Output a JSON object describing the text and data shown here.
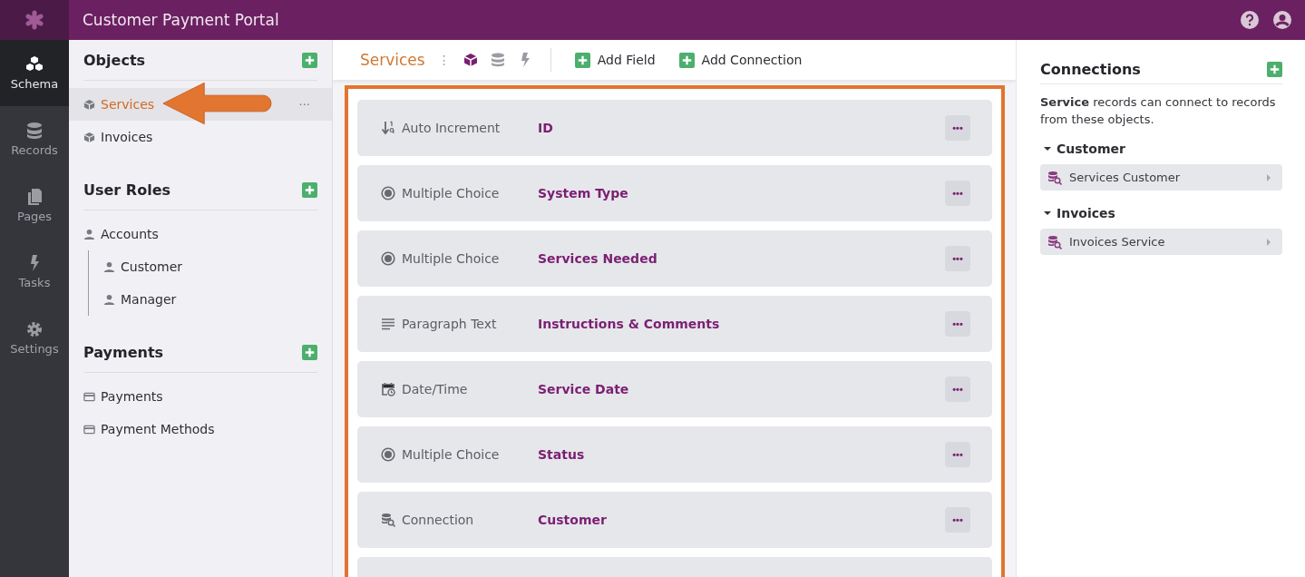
{
  "app": {
    "title": "Customer Payment Portal"
  },
  "nav": [
    {
      "label": "Schema",
      "kind": "schema",
      "selected": true
    },
    {
      "label": "Records",
      "kind": "records",
      "selected": false
    },
    {
      "label": "Pages",
      "kind": "pages",
      "selected": false
    },
    {
      "label": "Tasks",
      "kind": "tasks",
      "selected": false
    },
    {
      "label": "Settings",
      "kind": "settings",
      "selected": false
    }
  ],
  "sidebar": {
    "sections": [
      {
        "title": "Objects",
        "kind": "object",
        "items": [
          {
            "label": "Services",
            "selected": true,
            "menu": "···"
          },
          {
            "label": "Invoices",
            "selected": false
          }
        ]
      },
      {
        "title": "User Roles",
        "kind": "role",
        "items": [
          {
            "label": "Accounts",
            "selected": false,
            "children": [
              {
                "label": "Customer",
                "selected": false
              },
              {
                "label": "Manager",
                "selected": false
              }
            ]
          }
        ]
      },
      {
        "title": "Payments",
        "kind": "payment",
        "items": [
          {
            "label": "Payments",
            "selected": false
          },
          {
            "label": "Payment Methods",
            "selected": false
          }
        ]
      }
    ]
  },
  "toolbar": {
    "title": "Services",
    "menu": "⋮",
    "views": [
      {
        "kind": "object",
        "selected": true
      },
      {
        "kind": "records",
        "selected": false
      },
      {
        "kind": "tasks",
        "selected": false
      }
    ],
    "buttons": [
      "Add Field",
      "Add Connection"
    ]
  },
  "fields": [
    {
      "kind": "autoincrement",
      "type": "Auto Increment",
      "name": "ID",
      "menu": "•••"
    },
    {
      "kind": "choice",
      "type": "Multiple Choice",
      "name": "System Type",
      "menu": "•••"
    },
    {
      "kind": "choice",
      "type": "Multiple Choice",
      "name": "Services Needed",
      "menu": "•••"
    },
    {
      "kind": "paragraph",
      "type": "Paragraph Text",
      "name": "Instructions & Comments",
      "menu": "•••"
    },
    {
      "kind": "date",
      "type": "Date/Time",
      "name": "Service Date",
      "menu": "•••"
    },
    {
      "kind": "choice",
      "type": "Multiple Choice",
      "name": "Status",
      "menu": "•••"
    },
    {
      "kind": "connection",
      "type": "Connection",
      "name": "Customer",
      "menu": "•••"
    }
  ],
  "connections": {
    "title": "Connections",
    "description": "**Service** records can connect to records from these objects.",
    "groups": [
      {
        "title": "Customer",
        "expanded": true,
        "items": [
          "Services Customer"
        ]
      },
      {
        "title": "Invoices",
        "expanded": true,
        "items": [
          "Invoices Service"
        ]
      }
    ]
  }
}
